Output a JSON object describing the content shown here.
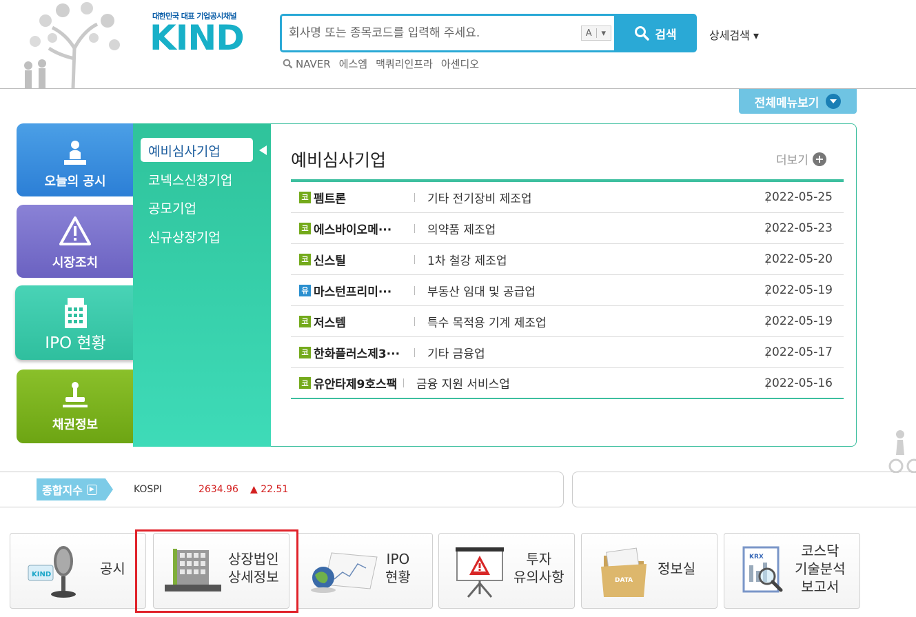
{
  "header": {
    "logo_tagline": "대한민국 대표 기업공시채널",
    "logo_word": "KIND",
    "search_placeholder": "회사명 또는 종목코드를 입력해 주세요.",
    "lang_toggle_label": "A",
    "lang_toggle_arrow": "▾",
    "search_button_label": "검색",
    "advanced_search_label": "상세검색 ▾",
    "hot_keywords": [
      "NAVER",
      "에스엠",
      "맥쿼리인프라",
      "아센디오"
    ]
  },
  "all_menu_label": "전체메뉴보기",
  "left_tabs": [
    {
      "label": "오늘의 공시",
      "icon": "person-podium-icon"
    },
    {
      "label": "시장조치",
      "icon": "warning-icon"
    },
    {
      "label": "IPO 현황",
      "icon": "building-icon"
    },
    {
      "label": "채권정보",
      "icon": "stamp-icon"
    }
  ],
  "submenu": [
    "예비심사기업",
    "코넥스신청기업",
    "공모기업",
    "신규상장기업"
  ],
  "panel": {
    "title": "예비심사기업",
    "more_label": "더보기",
    "rows": [
      {
        "market": "코",
        "name": "펨트론",
        "industry": "기타 전기장비 제조업",
        "date": "2022-05-25"
      },
      {
        "market": "코",
        "name": "에스바이오메···",
        "industry": "의약품 제조업",
        "date": "2022-05-23"
      },
      {
        "market": "코",
        "name": "신스틸",
        "industry": "1차 철강 제조업",
        "date": "2022-05-20"
      },
      {
        "market": "유",
        "name": "마스턴프리미···",
        "industry": "부동산 임대 및 공급업",
        "date": "2022-05-19"
      },
      {
        "market": "코",
        "name": "저스템",
        "industry": "특수 목적용 기계 제조업",
        "date": "2022-05-19"
      },
      {
        "market": "코",
        "name": "한화플러스제3···",
        "industry": "기타 금융업",
        "date": "2022-05-17"
      },
      {
        "market": "코",
        "name": "유안타제9호스팩",
        "industry": "금융 지원 서비스업",
        "date": "2022-05-16"
      }
    ]
  },
  "ticker": {
    "badge_label": "종합지수",
    "index_name": "KOSPI",
    "index_value": "2634.96",
    "change": "▲ 22.51"
  },
  "quick_links": [
    {
      "label": "공시",
      "icon": "microphone-icon"
    },
    {
      "label": "상장법인\n상세정보",
      "icon": "office-building-icon"
    },
    {
      "label": "IPO\n현황",
      "icon": "globe-chart-icon"
    },
    {
      "label": "투자\n유의사항",
      "icon": "warning-board-icon"
    },
    {
      "label": "정보실",
      "icon": "folder-data-icon"
    },
    {
      "label": "코스닥\n기술분석\n보고서",
      "icon": "report-magnifier-icon"
    }
  ],
  "colors": {
    "accent_blue": "#2aa9d6",
    "ipo_green": "#3dbf9f",
    "highlight_red": "#e0222a",
    "index_red": "#d32020"
  }
}
